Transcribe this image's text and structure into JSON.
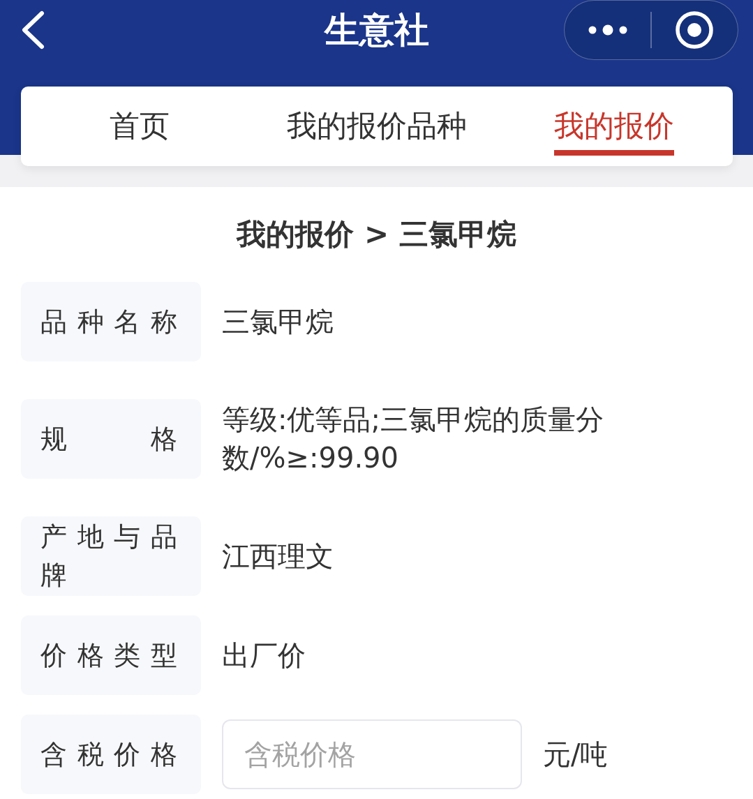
{
  "navbar": {
    "title": "生意社"
  },
  "tabs": [
    {
      "label": "首页",
      "selected": false
    },
    {
      "label": "我的报价品种",
      "selected": false
    },
    {
      "label": "我的报价",
      "selected": true
    }
  ],
  "breadcrumb": "我的报价 > 三氯甲烷",
  "fields": [
    {
      "kind": "text",
      "label": "品种名称",
      "value": "三氯甲烷"
    },
    {
      "kind": "text",
      "label": "规格",
      "value": "等级:优等品;三氯甲烷的质量分数/%≥:99.90"
    },
    {
      "kind": "text",
      "label": "产地与品牌",
      "value": "江西理文"
    },
    {
      "kind": "text",
      "label": "价格类型",
      "value": "出厂价"
    },
    {
      "kind": "input",
      "label": "含税价格",
      "placeholder": "含税价格",
      "unit": "元/吨"
    }
  ]
}
